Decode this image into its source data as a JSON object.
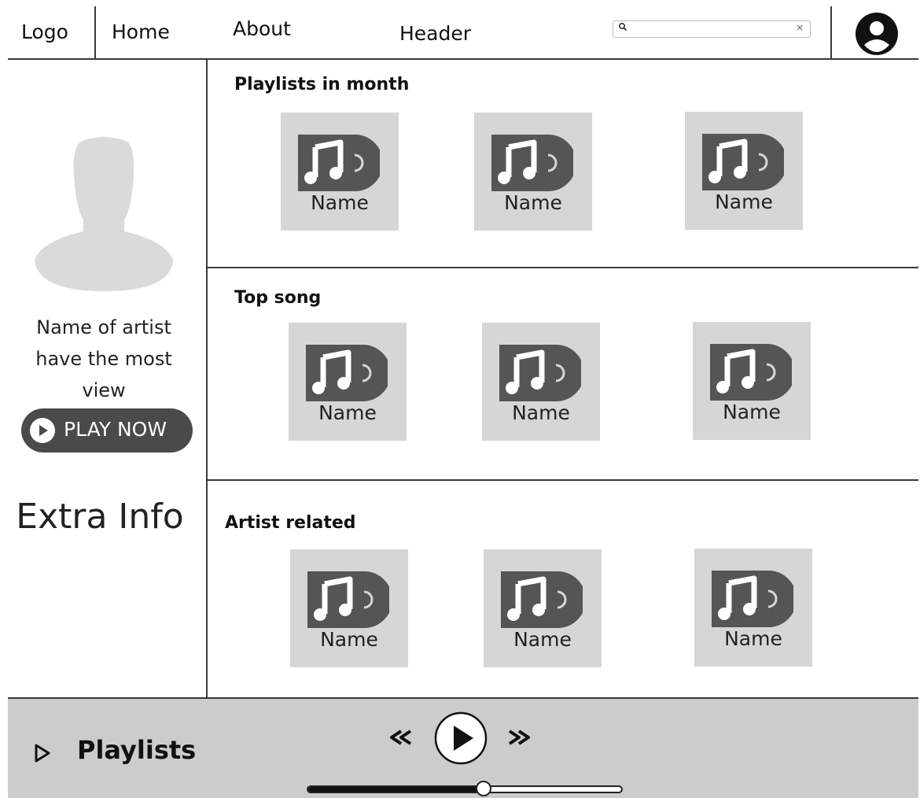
{
  "header": {
    "logo": "Logo",
    "nav": [
      "Home",
      "About"
    ],
    "title": "Header",
    "search": {
      "value": "",
      "placeholder": "",
      "icon": "search-icon",
      "clear": "×"
    },
    "account_icon": "user-avatar-icon"
  },
  "sidebar": {
    "artist_name": "Name of artist have the most view",
    "play_button_label": "PLAY NOW",
    "extra_info": "Extra Info"
  },
  "sections": [
    {
      "title": "Playlists in month",
      "items": [
        "Name",
        "Name",
        "Name"
      ]
    },
    {
      "title": "Top song",
      "items": [
        "Name",
        "Name",
        "Name"
      ]
    },
    {
      "title": "Artist related",
      "items": [
        "Name",
        "Name",
        "Name"
      ]
    }
  ],
  "footer": {
    "title": "Playlists",
    "progress_fraction": 0.56
  },
  "colors": {
    "card_bg": "#d6d6d6",
    "icon_dark": "#555555",
    "footer_bg": "#cccccc",
    "play_button_bg": "#4a4a4a"
  }
}
